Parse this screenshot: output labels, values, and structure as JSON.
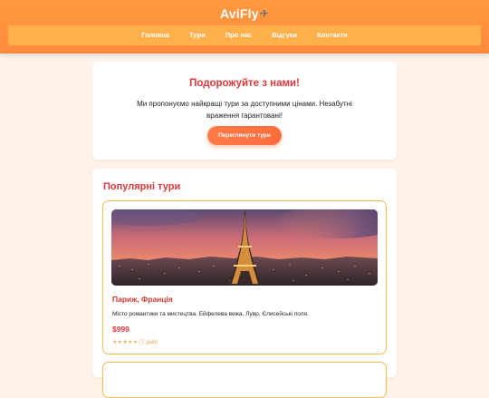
{
  "header": {
    "brand": "AviFly",
    "brand_icon": "airplane-icon"
  },
  "nav": {
    "items": [
      {
        "label": "Головна"
      },
      {
        "label": "Тури"
      },
      {
        "label": "Про нас"
      },
      {
        "label": "Відгуки"
      },
      {
        "label": "Контакти"
      }
    ]
  },
  "hero": {
    "title": "Подорожуйте з нами!",
    "text": "Ми пропонуємо найкращі тури за доступними цінами. Незабутні враження гарантовані!",
    "button_label": "Переглянути тури"
  },
  "tours": {
    "section_title": "Популярні тури",
    "items": [
      {
        "name": "Париж, Франція",
        "description": "Місто романтики та мистецтва. Ейфелева вежа, Лувр, Єлисейські поля.",
        "price": "$999",
        "stars": "★★★★★",
        "reviews": "(7 днів)"
      }
    ]
  },
  "colors": {
    "header": "#ff8a3c",
    "nav": "#ffb04a",
    "accent_red": "#e0383a",
    "card_border": "#f3b955",
    "page_bg": "#fdf3ea"
  }
}
